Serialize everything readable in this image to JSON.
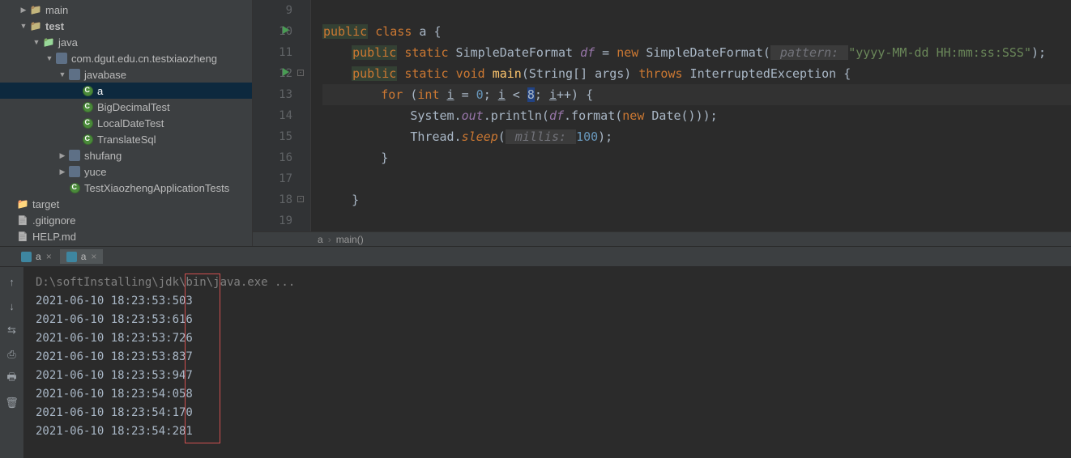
{
  "tree": [
    {
      "indent": 1,
      "arrow": "▶",
      "icon": "folder",
      "label": "main"
    },
    {
      "indent": 1,
      "arrow": "▼",
      "icon": "folder",
      "label": "test",
      "bold": true
    },
    {
      "indent": 2,
      "arrow": "▼",
      "icon": "folder-green",
      "label": "java"
    },
    {
      "indent": 3,
      "arrow": "▼",
      "icon": "pkg",
      "label": "com.dgut.edu.cn.testxiaozheng"
    },
    {
      "indent": 4,
      "arrow": "▼",
      "icon": "pkg",
      "label": "javabase"
    },
    {
      "indent": 5,
      "arrow": "",
      "icon": "class",
      "label": "a",
      "selected": true
    },
    {
      "indent": 5,
      "arrow": "",
      "icon": "class",
      "label": "BigDecimalTest"
    },
    {
      "indent": 5,
      "arrow": "",
      "icon": "class",
      "label": "LocalDateTest"
    },
    {
      "indent": 5,
      "arrow": "",
      "icon": "class",
      "label": "TranslateSql"
    },
    {
      "indent": 4,
      "arrow": "▶",
      "icon": "pkg",
      "label": "shufang"
    },
    {
      "indent": 4,
      "arrow": "▶",
      "icon": "pkg",
      "label": "yuce"
    },
    {
      "indent": 4,
      "arrow": "",
      "icon": "class",
      "label": "TestXiaozhengApplicationTests"
    },
    {
      "indent": 0,
      "arrow": "",
      "icon": "folder-orange",
      "label": "target"
    },
    {
      "indent": 0,
      "arrow": "",
      "icon": "file",
      "label": ".gitignore"
    },
    {
      "indent": 0,
      "arrow": "",
      "icon": "file",
      "label": "HELP.md"
    }
  ],
  "lines": {
    "start": 9,
    "rows": [
      {
        "n": 9,
        "raw": ""
      },
      {
        "n": 10,
        "run": true,
        "raw": "<span class='kw-public'>public</span> <span class='kw'>class</span> a {"
      },
      {
        "n": 11,
        "raw": "    <span class='kw-public'>public</span> <span class='kw'>static</span> SimpleDateFormat <span class='field'>df</span> = <span class='kw'>new</span> SimpleDateFormat(<span class='param'> pattern: </span><span class='str'>\"yyyy-MM-dd HH:mm:ss:SSS\"</span>);"
      },
      {
        "n": 12,
        "run": true,
        "fold": true,
        "raw": "    <span class='kw-public'>public</span> <span class='kw'>static</span> <span class='kw'>void</span> <span class='method'>main</span>(String[] args) <span class='kw'>throws</span> InterruptedException {"
      },
      {
        "n": 13,
        "hl": true,
        "raw": "        <span class='kw'>for</span> (<span class='kw'>int</span> <span class='under'>i</span> = <span class='num'>0</span>; <span class='under'>i</span> &lt; <span class='caret-box'>8</span>; <span class='under'>i</span>++) {"
      },
      {
        "n": 14,
        "raw": "            System.<span class='field'>out</span>.println(<span class='field'>df</span>.format(<span class='kw'>new</span> Date()));"
      },
      {
        "n": 15,
        "raw": "            Thread.<span class='stat'>sleep</span>(<span class='param'> millis: </span><span class='num'>100</span>);"
      },
      {
        "n": 16,
        "raw": "        }"
      },
      {
        "n": 17,
        "raw": ""
      },
      {
        "n": 18,
        "fold": true,
        "raw": "    }"
      },
      {
        "n": 19,
        "raw": ""
      }
    ]
  },
  "breadcrumb": {
    "class": "a",
    "method": "main()"
  },
  "runTabs": [
    {
      "label": "a",
      "active": false
    },
    {
      "label": "a",
      "active": true
    }
  ],
  "console": {
    "cmd": "D:\\softInstalling\\jdk\\bin\\java.exe ...",
    "lines": [
      "2021-06-10 18:23:53:503",
      "2021-06-10 18:23:53:616",
      "2021-06-10 18:23:53:726",
      "2021-06-10 18:23:53:837",
      "2021-06-10 18:23:53:947",
      "2021-06-10 18:23:54:058",
      "2021-06-10 18:23:54:170",
      "2021-06-10 18:23:54:281"
    ]
  },
  "toolbar": [
    "↑",
    "↓",
    "⇆",
    "⎙",
    "🖶",
    "🗑"
  ]
}
